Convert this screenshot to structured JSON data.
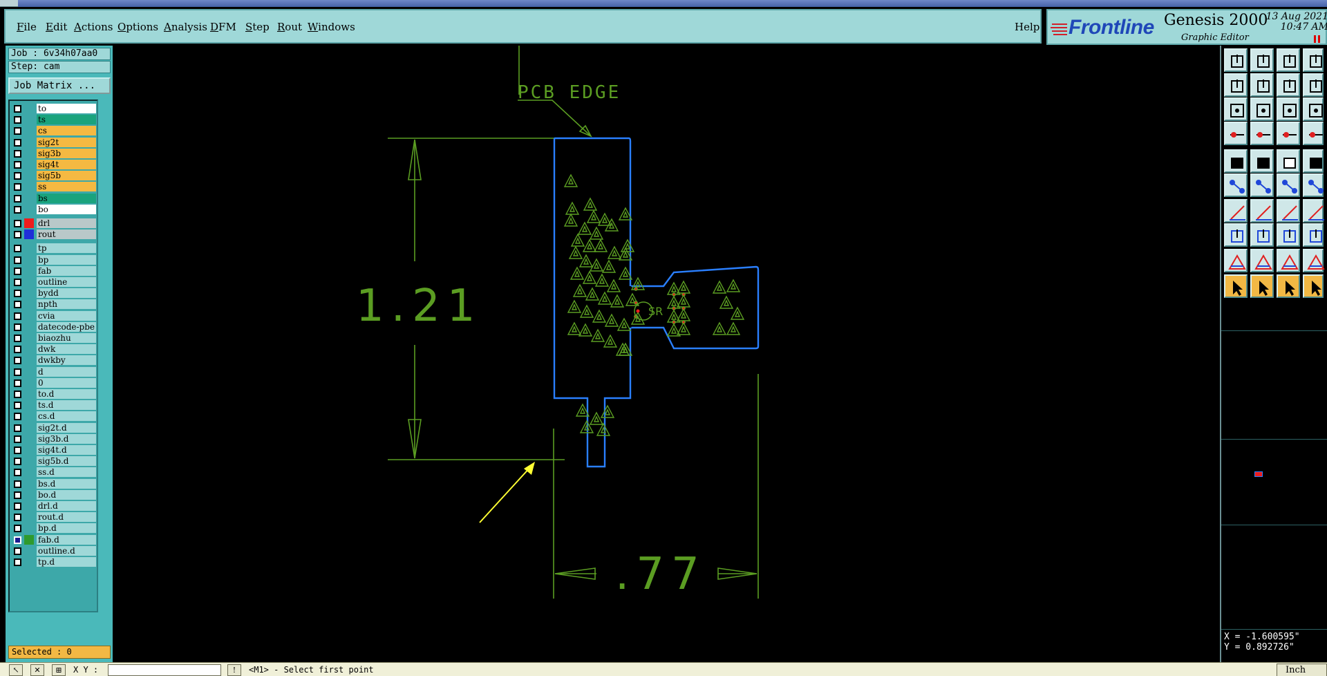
{
  "menu": {
    "items": [
      "File",
      "Edit",
      "Actions",
      "Options",
      "Analysis",
      "DFM",
      "Step",
      "Rout",
      "Windows"
    ],
    "underline": [
      "F",
      "E",
      "A",
      "O",
      "A",
      "D",
      "S",
      "R",
      "W"
    ],
    "help": "Help"
  },
  "brand": {
    "logo": "Frontline",
    "app": "Genesis 2000",
    "subtitle": "Graphic Editor",
    "date": "13 Aug 2021",
    "time": "10:47 AM"
  },
  "job": {
    "job_line": "Job : 6v34h07aa0",
    "step_line": "Step: cam",
    "matrix_button": "Job Matrix ..."
  },
  "colors": {
    "board": "#ffffff",
    "teal": "#1aa37d",
    "orange": "#f5b942",
    "drill_red": "#ee1c1c",
    "rout_blue": "#1f2fd8",
    "doc": "#9fd8d8",
    "fab_green": "#2e9a2e",
    "drawing_green": "#5b9d22",
    "outline_blue": "#2a7fff",
    "arrow_yellow": "#ffff33"
  },
  "layers": {
    "board": [
      {
        "name": "to",
        "color": "board"
      },
      {
        "name": "ts",
        "color": "teal"
      },
      {
        "name": "cs",
        "color": "orange"
      },
      {
        "name": "sig2t",
        "color": "orange"
      },
      {
        "name": "sig3b",
        "color": "orange"
      },
      {
        "name": "sig4t",
        "color": "orange"
      },
      {
        "name": "sig5b",
        "color": "orange"
      },
      {
        "name": "ss",
        "color": "orange"
      },
      {
        "name": "bs",
        "color": "teal"
      },
      {
        "name": "bo",
        "color": "board"
      }
    ],
    "drill": [
      {
        "name": "drl",
        "swatch": "drill_red"
      },
      {
        "name": "rout",
        "swatch": "rout_blue"
      }
    ],
    "doc": [
      "tp",
      "bp",
      "fab",
      "outline",
      "bydd",
      "npth",
      "cvia",
      "datecode-pbe",
      "biaozhu",
      "dwk",
      "dwkby",
      "d",
      "0",
      "to.d",
      "ts.d",
      "cs.d",
      "sig2t.d",
      "sig3b.d",
      "sig4t.d",
      "sig5b.d",
      "ss.d",
      "bs.d",
      "bo.d",
      "drl.d",
      "rout.d",
      "bp.d",
      "fab.d",
      "outline.d",
      "tp.d"
    ],
    "active_doc": "fab.d"
  },
  "selected": "Selected : 0",
  "drawing": {
    "pcb_edge_label": "PCB EDGE",
    "height_dim": "1.21",
    "width_dim": ".77",
    "ref_label": "SR"
  },
  "coords": {
    "x": "X = -1.600595\"",
    "y": "Y = 0.892726\""
  },
  "status": {
    "xy_label": "X Y :",
    "xy_value": "",
    "prompt": "<M1> - Select first point",
    "units": "Inch"
  },
  "toolbar_icons": [
    "open-job-icon",
    "save-icon",
    "home-icon",
    "snap-icon",
    "step-left-icon",
    "step-right-icon",
    "mirror-icon",
    "redraw-icon",
    "zoom-fit-icon",
    "zoom-center-icon",
    "ratio-icon",
    "help-icon",
    "feature-filter-icon",
    "pad-icon",
    "net-icon",
    "layer-compare-icon",
    "fill-icon",
    "edit-shape-icon",
    "measure-icon",
    "drill-icon",
    "connect-icon",
    "delete-icon",
    "add-line-icon",
    "arc-icon",
    "angle-icon",
    "slash-icon",
    "rotate-icon",
    "split-icon",
    "move-icon",
    "line-icon",
    "grid-icon",
    "copy-icon",
    "triangle-icon",
    "triangle-edit-icon",
    "triangle-text-icon",
    "triangle-measure-icon",
    "pointer-icon",
    "select-icon",
    "select-area-icon",
    "route-icon"
  ]
}
